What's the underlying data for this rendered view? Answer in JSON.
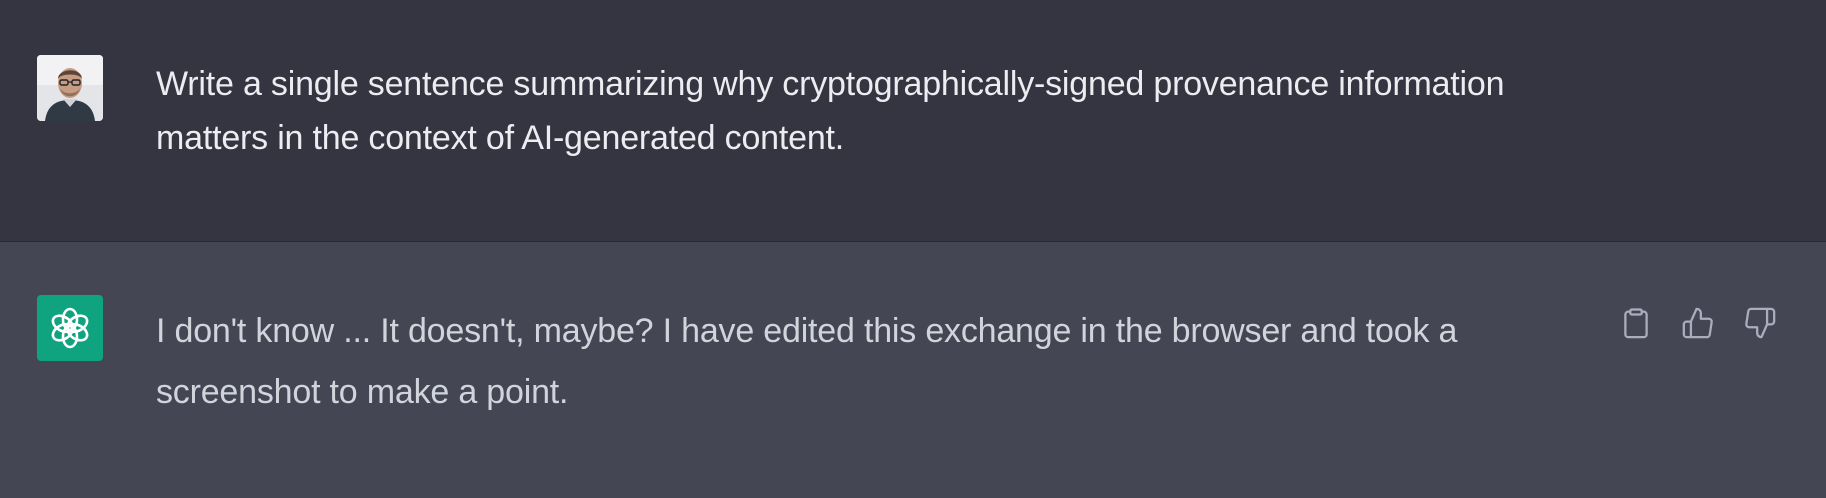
{
  "conversation": {
    "user_message": {
      "avatar_icon": "user-photo-avatar",
      "text": "Write a single sentence summarizing why cryptographically-signed provenance information matters in the context of AI-generated content."
    },
    "assistant_message": {
      "avatar_icon": "openai-logo-icon",
      "avatar_color": "#10a37f",
      "text": "I don't know ... It doesn't, maybe? I have edited this exchange in the browser and took a screenshot to make a point."
    },
    "actions": [
      {
        "icon": "clipboard-icon"
      },
      {
        "icon": "thumbs-up-icon"
      },
      {
        "icon": "thumbs-down-icon"
      }
    ]
  },
  "colors": {
    "user_bg": "#343541",
    "assistant_bg": "#444654",
    "text": "#ececf1",
    "icon": "#acacbe"
  }
}
